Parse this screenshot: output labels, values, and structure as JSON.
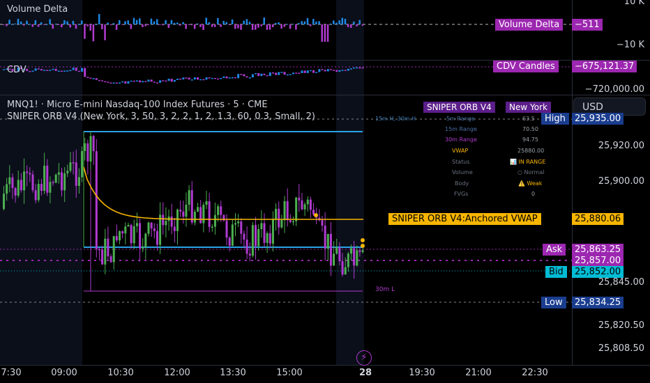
{
  "colors": {
    "bg": "#000000",
    "up": "#4caf50",
    "down": "#b13bd1",
    "cyan": "#1e88e5",
    "orange": "#f7b500",
    "magenta": "#9c27b0",
    "blue_tag": "#1848cc"
  },
  "volume_delta": {
    "title": "Volume Delta",
    "axis": [
      "10 K",
      "−10 K"
    ],
    "tag_label": "Volume Delta",
    "tag_value": "−511"
  },
  "cdv": {
    "title": "CDV",
    "tag_label": "CDV Candles",
    "tag_value": "−675,121.37",
    "axis": [
      "−720,000.00"
    ]
  },
  "main": {
    "symbol_line": "MNQ1! · Micro E-mini Nasdaq-100 Index Futures · 5 · CME",
    "indicator_line": "SNIPER ORB V4 (New York, 3, 50, 3, 2, 2, 1, 2, 1.3, 60, 0.3, Small, 2)",
    "currency": "USD",
    "price_axis": [
      "25,920.00",
      "25,900.00",
      "25,845.00",
      "25,820.50",
      "25,808.50"
    ],
    "tags": {
      "high_label": "High",
      "high_value": "25,935.00",
      "vwap_label": "SNIPER ORB V4:Anchored VWAP",
      "vwap_value": "25,880.06",
      "ask_label": "Ask",
      "ask_value": "25,863.25",
      "last_value": "25,857.00",
      "bid_label": "Bid",
      "bid_value": "25,852.00",
      "low_label": "Low",
      "low_value": "25,834.25"
    },
    "range_label_30m": "30m L",
    "range_label_top": "15m H, 30m H"
  },
  "orb_panel": {
    "title": "SNIPER ORB V4",
    "session": "New York",
    "rows": [
      {
        "label": "5m Range",
        "value": "63.5"
      },
      {
        "label": "15m Range",
        "value": "70.50"
      },
      {
        "label": "30m Range",
        "value": "94.75"
      },
      {
        "label": "VWAP",
        "value": "25880.00"
      },
      {
        "label": "Status",
        "value": "📊 IN RANGE"
      },
      {
        "label": "Volume",
        "value": "○ Normal"
      },
      {
        "label": "Body",
        "value": "⚠️ Weak"
      },
      {
        "label": "FVGs",
        "value": "0"
      }
    ]
  },
  "time_axis": [
    "7:30",
    "09:00",
    "10:30",
    "12:00",
    "13:30",
    "15:00",
    "28",
    "19:30",
    "21:00",
    "22:30"
  ]
}
